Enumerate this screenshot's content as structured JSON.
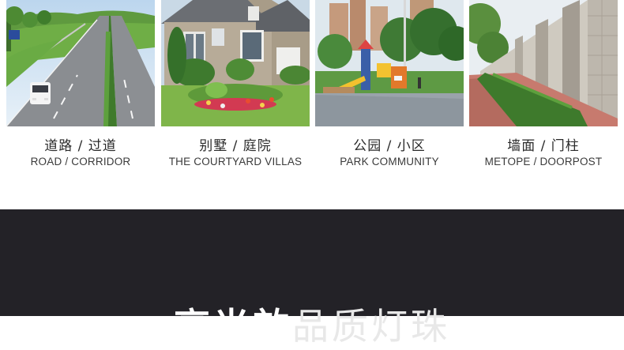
{
  "scenes": [
    {
      "cn": "道路 / 过道",
      "en": "ROAD / CORRIDOR",
      "icon": "road-photo"
    },
    {
      "cn": "别墅 / 庭院",
      "en": "THE COURTYARD VILLAS",
      "icon": "villa-photo"
    },
    {
      "cn": "公园 / 小区",
      "en": "PARK COMMUNITY",
      "icon": "park-photo"
    },
    {
      "cn": "墙面 / 门柱",
      "en": "METOPE / DOORPOST",
      "icon": "wall-photo"
    }
  ],
  "banner": {
    "headline_bold": "高光效",
    "headline_light": "品质灯珠"
  },
  "colors": {
    "banner_bg": "#232227",
    "page_bg": "#ffffff"
  }
}
